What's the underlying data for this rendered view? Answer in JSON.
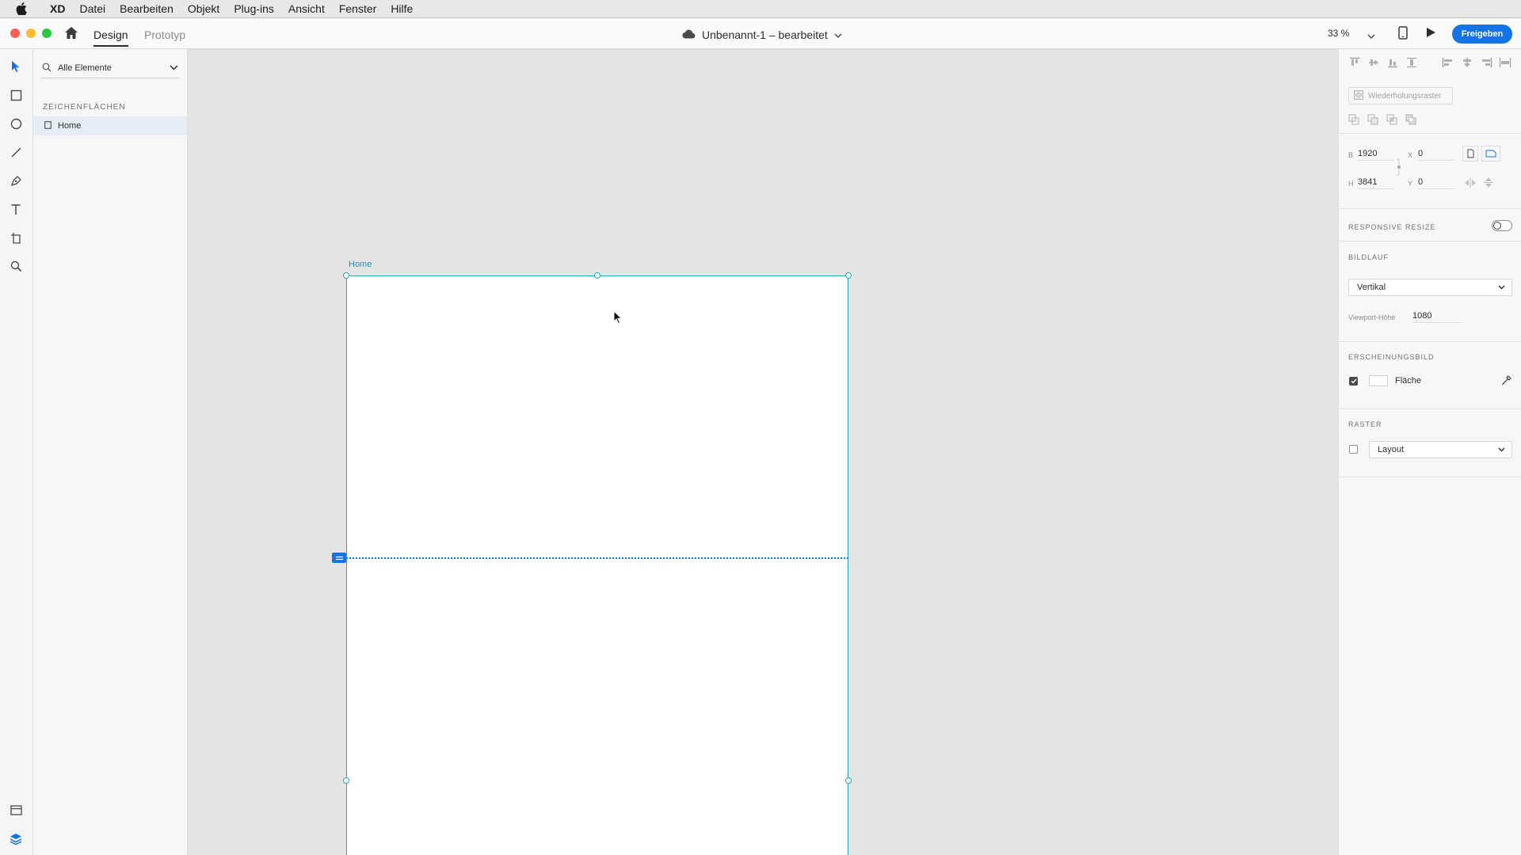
{
  "menubar": {
    "app": "XD",
    "items": [
      "Datei",
      "Bearbeiten",
      "Objekt",
      "Plug-ins",
      "Ansicht",
      "Fenster",
      "Hilfe"
    ]
  },
  "titlebar": {
    "tabs": [
      "Design",
      "Prototyp"
    ],
    "document_title": "Unbenannt-1 – bearbeitet",
    "zoom": "33 %",
    "share_label": "Freigeben"
  },
  "layers": {
    "search_placeholder": "Alle Elemente",
    "section_title": "ZEICHENFLÄCHEN",
    "artboards": [
      "Home"
    ]
  },
  "canvas": {
    "artboard_name": "Home"
  },
  "inspector": {
    "repeat_grid": "Wiederholungsraster",
    "w_label": "B",
    "w_value": "1920",
    "x_label": "X",
    "x_value": "0",
    "h_label": "H",
    "h_value": "3841",
    "y_label": "Y",
    "y_value": "0",
    "responsive_resize": "RESPONSIVE RESIZE",
    "scrolling_title": "BILDLAUF",
    "scrolling_value": "Vertikal",
    "viewport_label": "Viewport-Höhe",
    "viewport_value": "1080",
    "appearance_title": "ERSCHEINUNGSBILD",
    "fill_label": "Fläche",
    "grid_title": "RASTER",
    "grid_value": "Layout"
  },
  "colors": {
    "accent": "#1473e6",
    "artboard_border": "#2ba3b5"
  }
}
